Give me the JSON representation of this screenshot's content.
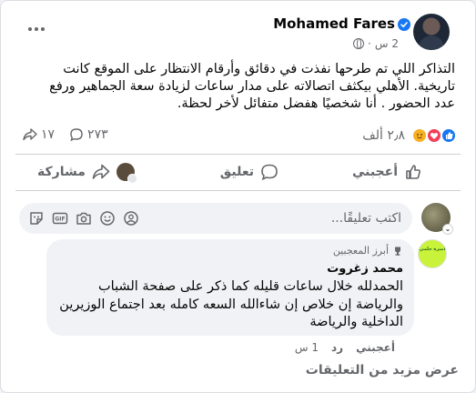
{
  "post": {
    "author": "Mohamed Fares",
    "time": "2 س",
    "text": "التذاكر اللي تم طرحها نفذت في دقائق وأرقام الانتظار على الموقع كانت تاريخية. الأهلي بيكثف اتصالاته على مدار ساعات لزيادة سعة الجماهير ورفع عدد الحضور . أنا شخصيًا هفضل متفائل لأخر لحظة.",
    "reactions_count": "٢٫٨ ألف",
    "comments_count": "٢٧٣",
    "shares_count": "١٧",
    "icons": {
      "verified": "verified-badge-icon",
      "audience": "globe-icon",
      "menu": "more-horizontal-icon"
    }
  },
  "actions": {
    "like": "أعجبني",
    "comment": "تعليق",
    "share": "مشاركة"
  },
  "comment_input": {
    "placeholder": "اكتب تعليقًا..."
  },
  "comment": {
    "badge": "أبرز المعجبين",
    "author": "محمد زغروت",
    "text": "الحمدلله خلال ساعات قليله كما ذكر على صفحة الشباب والرياضة إن خلاص إن شاءالله السعه كامله بعد اجتماع الوزيرين الداخلية والرياضة",
    "like": "أعجبني",
    "reply": "رد",
    "time": "1 س",
    "avatar_text": "أميرة حلمي"
  },
  "more_comments": "عرض مزيد من التعليقات",
  "colors": {
    "like_blue": "#1877f2",
    "love_red": "#f33e58",
    "care_yellow": "#f7b125",
    "secondary_text": "#65676b",
    "bubble_bg": "#f0f2f5"
  }
}
